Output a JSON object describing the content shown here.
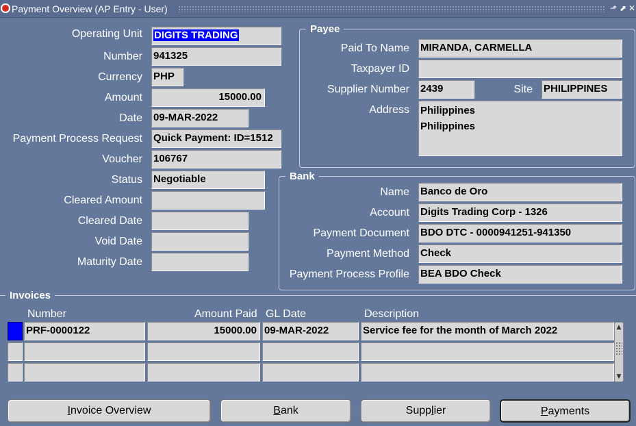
{
  "window": {
    "title": "Payment Overview (AP Entry - User)",
    "minimize_glyph": "⬏",
    "maximize_glyph": "⬈",
    "close_glyph": "✕"
  },
  "payment": {
    "operating_unit_label": "Operating Unit",
    "operating_unit": "DIGITS TRADING",
    "number_label": "Number",
    "number": "941325",
    "currency_label": "Currency",
    "currency": "PHP",
    "amount_label": "Amount",
    "amount": "15000.00",
    "date_label": "Date",
    "date": "09-MAR-2022",
    "ppr_label": "Payment Process Request",
    "ppr": "Quick Payment: ID=1512",
    "voucher_label": "Voucher",
    "voucher": "106767",
    "status_label": "Status",
    "status": "Negotiable",
    "cleared_amount_label": "Cleared Amount",
    "cleared_amount": "",
    "cleared_date_label": "Cleared Date",
    "cleared_date": "",
    "void_date_label": "Void Date",
    "void_date": "",
    "maturity_date_label": "Maturity Date",
    "maturity_date": ""
  },
  "payee": {
    "group_title": "Payee",
    "paid_to_name_label": "Paid To Name",
    "paid_to_name": "MIRANDA, CARMELLA",
    "taxpayer_id_label": "Taxpayer ID",
    "taxpayer_id": "",
    "supplier_number_label": "Supplier Number",
    "supplier_number": "2439",
    "site_label": "Site",
    "site": "PHILIPPINES",
    "address_label": "Address",
    "address_line1": "Philippines",
    "address_line2": "Philippines"
  },
  "bank": {
    "group_title": "Bank",
    "name_label": "Name",
    "name": "Banco de Oro",
    "account_label": "Account",
    "account": "Digits Trading Corp - 1326",
    "payment_document_label": "Payment Document",
    "payment_document": "BDO DTC - 0000941251-941350",
    "payment_method_label": "Payment Method",
    "payment_method": "Check",
    "payment_process_profile_label": "Payment Process Profile",
    "payment_process_profile": "BEA BDO Check"
  },
  "invoices": {
    "group_title": "Invoices",
    "columns": [
      "Number",
      "Amount Paid",
      "GL Date",
      "Description"
    ],
    "rows": [
      {
        "number": "PRF-0000122",
        "amount_paid": "15000.00",
        "gl_date": "09-MAR-2022",
        "description": "Service fee for the month of March 2022"
      },
      {
        "number": "",
        "amount_paid": "",
        "gl_date": "",
        "description": ""
      },
      {
        "number": "",
        "amount_paid": "",
        "gl_date": "",
        "description": ""
      }
    ]
  },
  "buttons": {
    "invoice_overview_mnemonic": "I",
    "invoice_overview_rest": "nvoice Overview",
    "bank_mnemonic": "B",
    "bank_rest": "ank",
    "supplier_pre": "Supp",
    "supplier_mnemonic": "l",
    "supplier_rest": "ier",
    "payments_mnemonic": "P",
    "payments_rest": "ayments"
  }
}
